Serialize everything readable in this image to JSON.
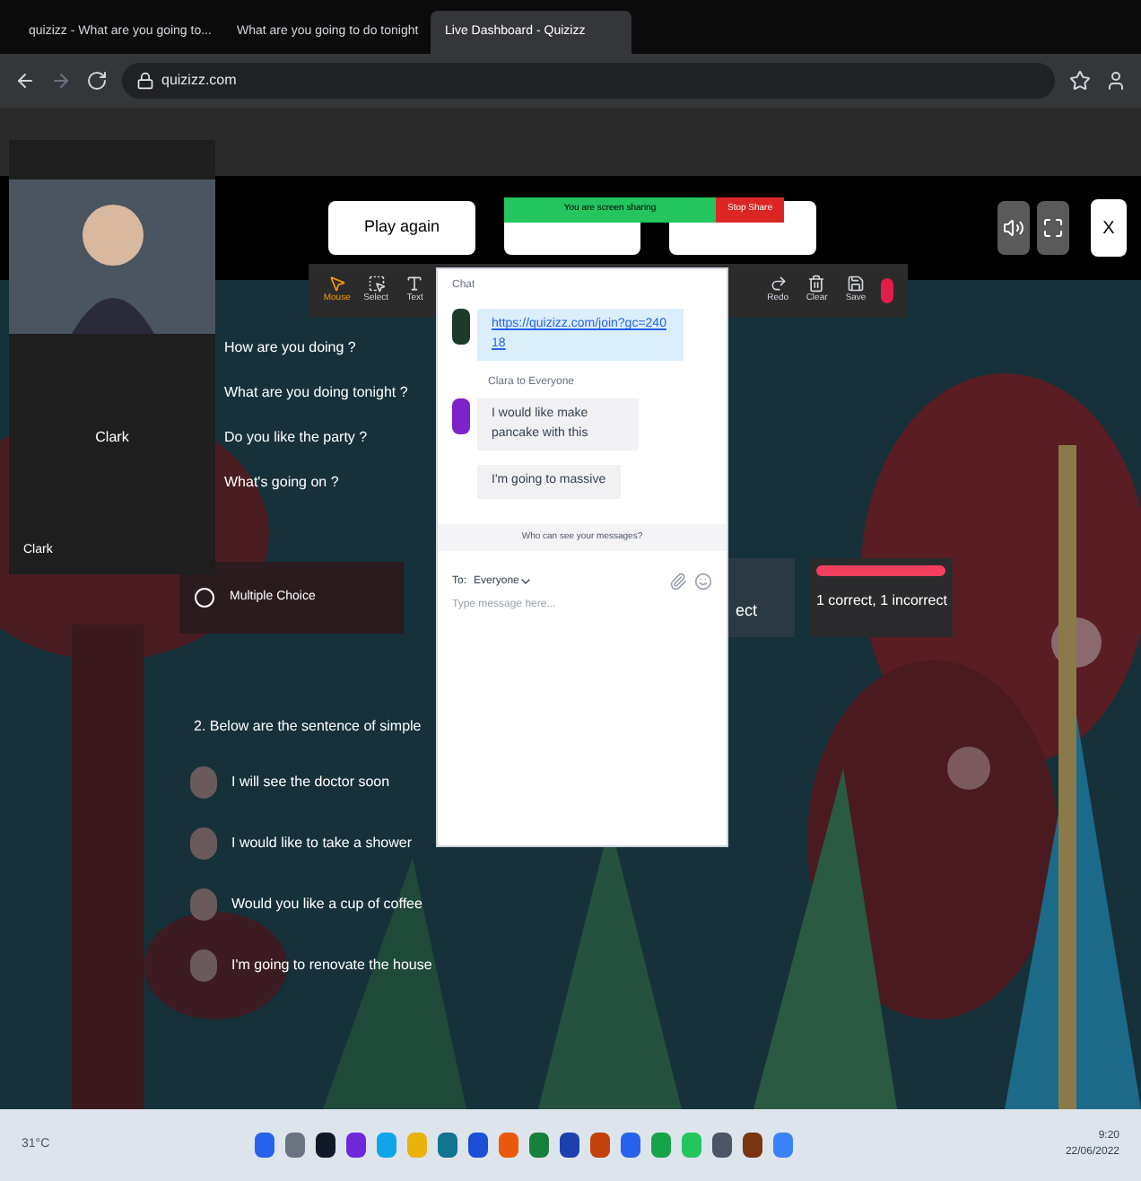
{
  "browser": {
    "tabs": [
      {
        "title": "quizizz - What are you going to...",
        "selected": false
      },
      {
        "title": "What are you going to do tonight",
        "selected": false
      },
      {
        "title": "Live Dashboard - Quizizz",
        "selected": true
      }
    ],
    "address": "quizizz.com"
  },
  "video_panel": {
    "tile_name": "Clark",
    "footer_name": "Clark"
  },
  "game": {
    "play_again": "Play again",
    "share_bar": {
      "text": "You are screen sharing",
      "stop": "Stop Share"
    },
    "close": "X"
  },
  "annotation_tools": [
    {
      "label": "Mouse",
      "selected": true
    },
    {
      "label": "Select",
      "selected": false
    },
    {
      "label": "Text",
      "selected": false
    },
    {
      "label": "Redo",
      "selected": false
    },
    {
      "label": "Clear",
      "selected": false
    },
    {
      "label": "Save",
      "selected": false
    }
  ],
  "questions": [
    "How are you doing ?",
    "What are you doing tonight ?",
    "Do you like the party ?",
    "What's going on ?"
  ],
  "question_card": {
    "type": "Multiple Choice",
    "hidden_stat": "ect",
    "result": "1 correct, 1 incorrect"
  },
  "question_2": {
    "title": "2. Below are the sentence of simple",
    "options": [
      {
        "text": "I will see the doctor soon",
        "selected": false
      },
      {
        "text": "I would like to take a shower",
        "selected": false
      },
      {
        "text": "Would you like a cup of coffee",
        "selected": false
      },
      {
        "text": "I'm going to renovate the house",
        "selected": false
      }
    ]
  },
  "chat": {
    "title": "Chat",
    "link": "https://quizizz.com/join?gc=24018",
    "sender": "Clara to Everyone",
    "messages": [
      "I would like make pancake with this",
      "I'm going to massive"
    ],
    "notice": "Who can see your messages?",
    "to_label": "To:",
    "to": "Everyone",
    "placeholder": "Type message here..."
  },
  "taskbar": {
    "weather": "31°C",
    "time": "9:20",
    "date": "22/06/2022"
  }
}
